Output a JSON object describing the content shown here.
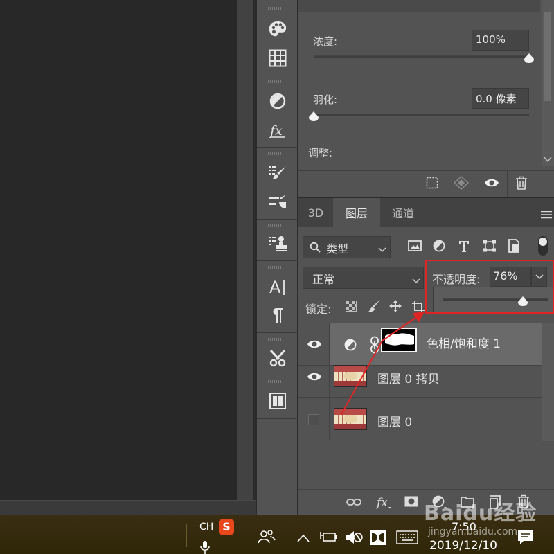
{
  "properties": {
    "density_label": "浓度:",
    "density_value": "100%",
    "density_fraction": 1.0,
    "feather_label": "羽化:",
    "feather_value": "0.0 像素",
    "feather_fraction": 0.0,
    "refine_label": "调整:"
  },
  "layers_panel": {
    "tabs": [
      {
        "label": "3D",
        "active": false
      },
      {
        "label": "图层",
        "active": true
      },
      {
        "label": "通道",
        "active": false
      }
    ],
    "filter_label": "类型",
    "blend_mode": "正常",
    "opacity_label": "不透明度:",
    "opacity_value": "76%",
    "opacity_fraction": 0.76,
    "lock_label": "锁定:",
    "layers": [
      {
        "name": "色相/饱和度 1",
        "visible": true,
        "selected": true,
        "kind": "adjustment"
      },
      {
        "name": "图层 0 拷贝",
        "visible": true,
        "selected": false,
        "kind": "pixel"
      },
      {
        "name": "图层 0",
        "visible": false,
        "selected": false,
        "kind": "pixel"
      }
    ]
  },
  "colors": {
    "panel": "#535353",
    "highlight_box": "#e02424",
    "arrow": "#e02424"
  },
  "taskbar": {
    "ime_label": "CH",
    "ime_logo": "S",
    "time": "7:50",
    "date": "2019/12/10"
  },
  "watermark": {
    "brand": "Baidu经验",
    "url": "jingyan.baidu.com"
  }
}
